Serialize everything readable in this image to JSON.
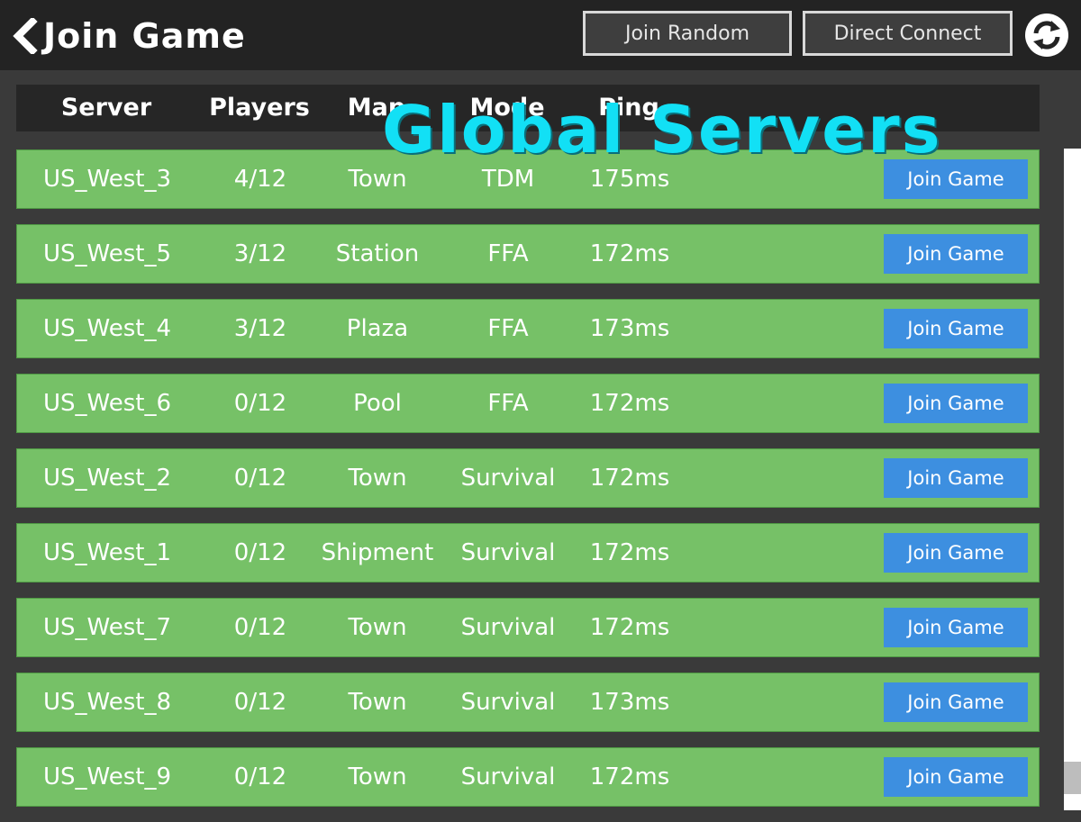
{
  "header": {
    "title": "Join Game",
    "join_random_label": "Join Random",
    "direct_connect_label": "Direct Connect"
  },
  "overlay_title": "Global Servers",
  "table": {
    "columns": [
      "Server",
      "Players",
      "Map",
      "Mode",
      "Ping"
    ],
    "join_label": "Join Game",
    "rows": [
      {
        "server": "US_West_3",
        "players": "4/12",
        "map": "Town",
        "mode": "TDM",
        "ping": "175ms"
      },
      {
        "server": "US_West_5",
        "players": "3/12",
        "map": "Station",
        "mode": "FFA",
        "ping": "172ms"
      },
      {
        "server": "US_West_4",
        "players": "3/12",
        "map": "Plaza",
        "mode": "FFA",
        "ping": "173ms"
      },
      {
        "server": "US_West_6",
        "players": "0/12",
        "map": "Pool",
        "mode": "FFA",
        "ping": "172ms"
      },
      {
        "server": "US_West_2",
        "players": "0/12",
        "map": "Town",
        "mode": "Survival",
        "ping": "172ms"
      },
      {
        "server": "US_West_1",
        "players": "0/12",
        "map": "Shipment",
        "mode": "Survival",
        "ping": "172ms"
      },
      {
        "server": "US_West_7",
        "players": "0/12",
        "map": "Town",
        "mode": "Survival",
        "ping": "172ms"
      },
      {
        "server": "US_West_8",
        "players": "0/12",
        "map": "Town",
        "mode": "Survival",
        "ping": "173ms"
      },
      {
        "server": "US_West_9",
        "players": "0/12",
        "map": "Town",
        "mode": "Survival",
        "ping": "172ms"
      }
    ]
  },
  "icons": {
    "back": "chevron-left-icon",
    "refresh": "refresh-icon"
  },
  "colors": {
    "row_green": "#76c167",
    "join_blue": "#3d8fe0",
    "title_cyan": "#12e0f5"
  }
}
